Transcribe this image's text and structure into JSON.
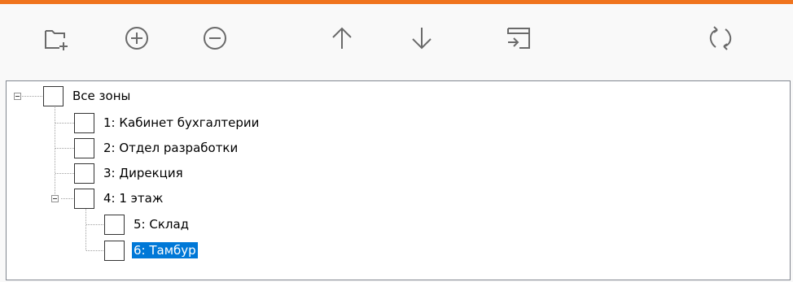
{
  "colors": {
    "accent": "#f0741e",
    "selection": "#0078d7",
    "icon": "#6a6a6a"
  },
  "toolbar": {
    "buttons": [
      {
        "icon": "new-folder-icon"
      },
      {
        "icon": "add-circle-icon"
      },
      {
        "icon": "remove-circle-icon"
      },
      {
        "icon": "arrow-up-icon"
      },
      {
        "icon": "arrow-down-icon"
      },
      {
        "icon": "import-icon"
      },
      {
        "icon": "refresh-icon"
      }
    ]
  },
  "tree": {
    "nodes": [
      {
        "label": "Все зоны",
        "level": 0,
        "expanded": true,
        "checked": false,
        "selected": false
      },
      {
        "label": "1: Кабинет бухгалтерии",
        "level": 1,
        "checked": false,
        "selected": false
      },
      {
        "label": "2: Отдел разработки",
        "level": 1,
        "checked": false,
        "selected": false
      },
      {
        "label": "3: Дирекция",
        "level": 1,
        "checked": false,
        "selected": false
      },
      {
        "label": "4: 1 этаж",
        "level": 1,
        "expanded": true,
        "checked": false,
        "selected": false
      },
      {
        "label": "5: Склад",
        "level": 2,
        "checked": false,
        "selected": false
      },
      {
        "label": "6: Тамбур",
        "level": 2,
        "checked": false,
        "selected": true
      }
    ]
  }
}
